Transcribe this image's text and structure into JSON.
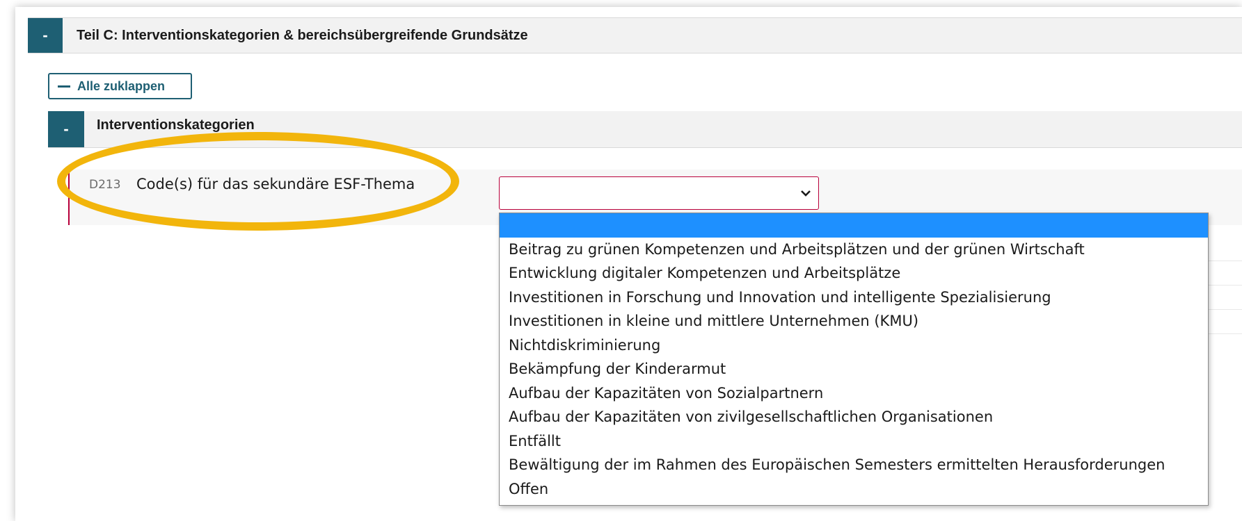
{
  "section": {
    "collapse_symbol": "-",
    "title": "Teil C: Interventionskategorien & bereichsübergreifende Grundsätze"
  },
  "toolbar": {
    "collapse_all_label": "Alle zuklappen"
  },
  "subsection": {
    "collapse_symbol": "-",
    "title": "Interventionskategorien"
  },
  "field": {
    "code": "D213",
    "label": "Code(s) für das sekundäre ESF-Thema",
    "selected_value": ""
  },
  "dropdown": {
    "options": [
      "",
      "Beitrag zu grünen Kompetenzen und Arbeitsplätzen und der grünen Wirtschaft",
      "Entwicklung digitaler Kompetenzen und Arbeitsplätze",
      "Investitionen in Forschung und Innovation und intelligente Spezialisierung",
      "Investitionen in kleine und mittlere Unternehmen (KMU)",
      "Nichtdiskriminierung",
      "Bekämpfung der Kinderarmut",
      "Aufbau der Kapazitäten von Sozialpartnern",
      "Aufbau der Kapazitäten von zivilgesellschaftlichen Organisationen",
      "Entfällt",
      "Bewältigung der im Rahmen des Europäischen Semesters ermittelten Herausforderungen",
      "Offen"
    ],
    "highlighted_index": 0
  },
  "colors": {
    "accent": "#1e5f73",
    "required_border": "#b8003a",
    "highlight_ring": "#f2b50c",
    "option_selected": "#1e90ff"
  }
}
